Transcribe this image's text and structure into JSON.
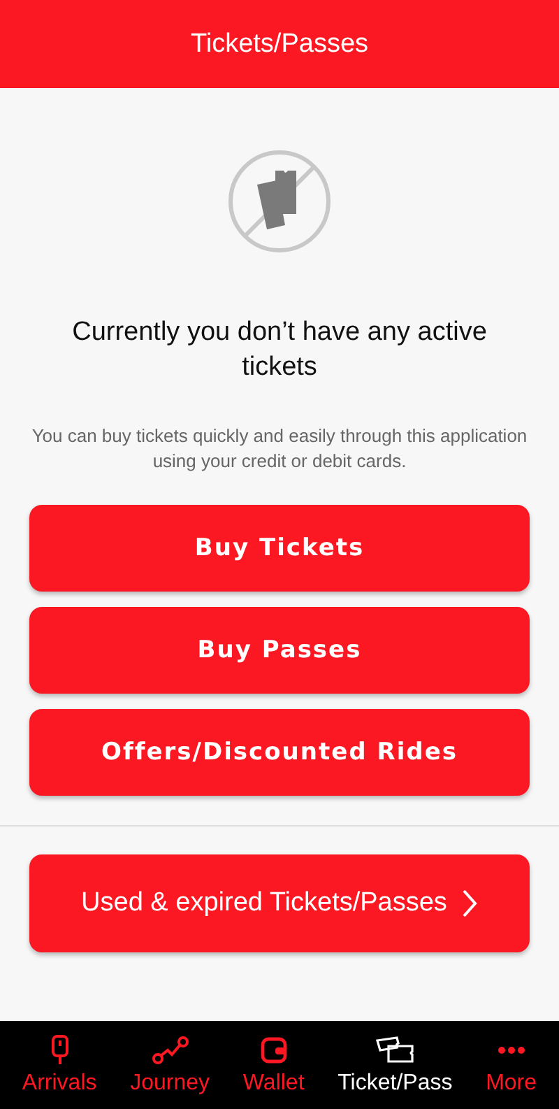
{
  "header": {
    "title": "Tickets/Passes"
  },
  "empty_state": {
    "heading": "Currently you don’t have any active tickets",
    "description": "You can buy tickets quickly and easily through this application using your credit or debit cards."
  },
  "actions": [
    "Buy Tickets",
    "Buy Passes",
    "Offers/Discounted Rides"
  ],
  "history_button": {
    "label": "Used & expired Tickets/Passes"
  },
  "nav": [
    {
      "label": "Arrivals",
      "kind": "arrivals",
      "selected": false
    },
    {
      "label": "Journey",
      "kind": "journey",
      "selected": false
    },
    {
      "label": "Wallet",
      "kind": "wallet",
      "selected": false
    },
    {
      "label": "Ticket/Pass",
      "kind": "tickets",
      "selected": true
    },
    {
      "label": "More",
      "kind": "more",
      "selected": false
    }
  ]
}
